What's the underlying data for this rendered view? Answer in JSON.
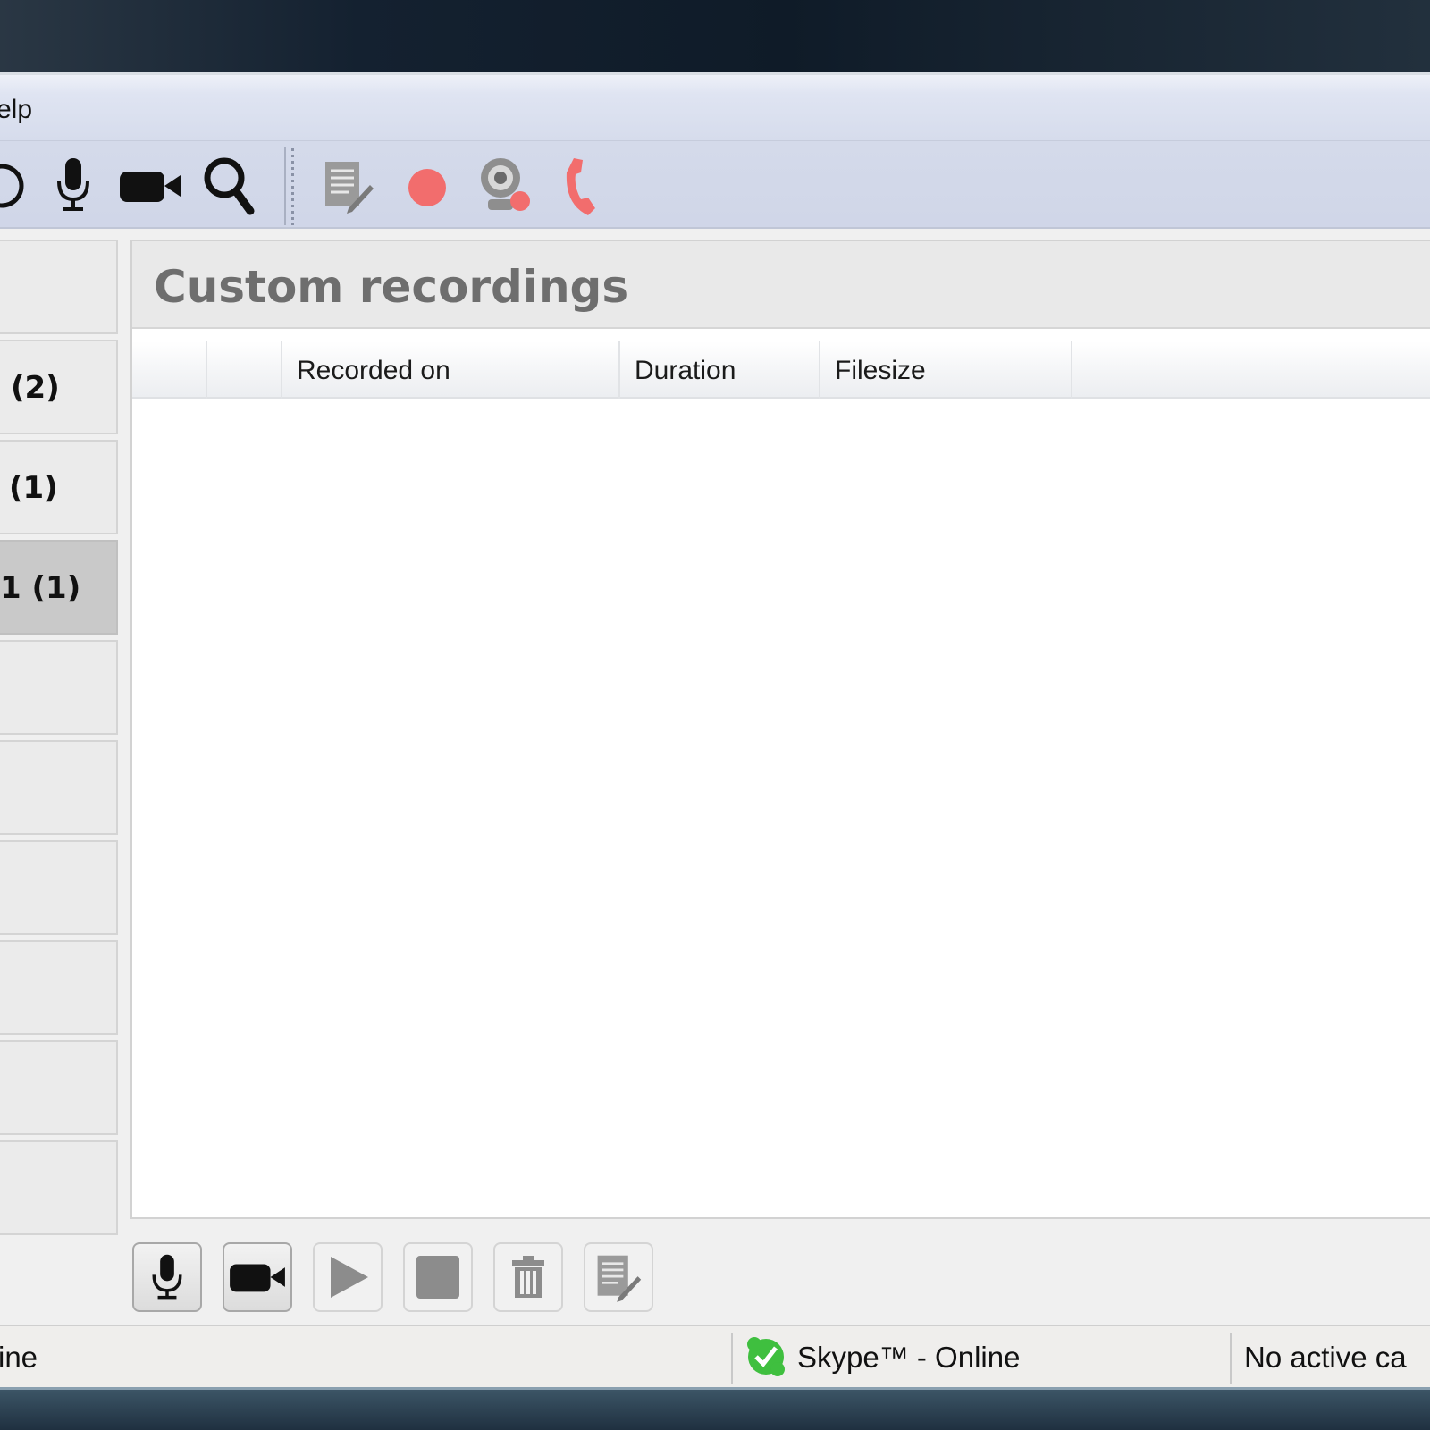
{
  "menu": {
    "items": [
      "elp"
    ]
  },
  "toolbar": {
    "icons": [
      "clock-icon",
      "microphone-icon",
      "video-camera-icon",
      "search-icon",
      "notes-icon",
      "record-icon",
      "webcam-record-icon",
      "phone-icon"
    ]
  },
  "sidebar": {
    "items": [
      {
        "label": ""
      },
      {
        "label": "(2)"
      },
      {
        "label": "(1)"
      },
      {
        "label": "1 (1)",
        "selected": true
      },
      {
        "label": ""
      },
      {
        "label": ""
      },
      {
        "label": ""
      },
      {
        "label": ""
      },
      {
        "label": ""
      },
      {
        "label": ""
      }
    ]
  },
  "panel": {
    "title": "Custom recordings",
    "columns": [
      "",
      "",
      "Recorded on",
      "Duration",
      "Filesize",
      ""
    ]
  },
  "bottom_toolbar": {
    "buttons": [
      {
        "icon": "microphone-icon",
        "enabled": true
      },
      {
        "icon": "video-camera-icon",
        "enabled": true
      },
      {
        "icon": "play-icon",
        "enabled": false
      },
      {
        "icon": "stop-icon",
        "enabled": false
      },
      {
        "icon": "trash-icon",
        "enabled": false
      },
      {
        "icon": "notes-icon",
        "enabled": false
      }
    ]
  },
  "status": {
    "left": "ine",
    "skype": "Skype™ - Online",
    "call": "No active ca"
  },
  "colors": {
    "record_red": "#f26d6d",
    "skype_green": "#3fbf3f",
    "panel_title_gray": "#6e6e6e"
  }
}
